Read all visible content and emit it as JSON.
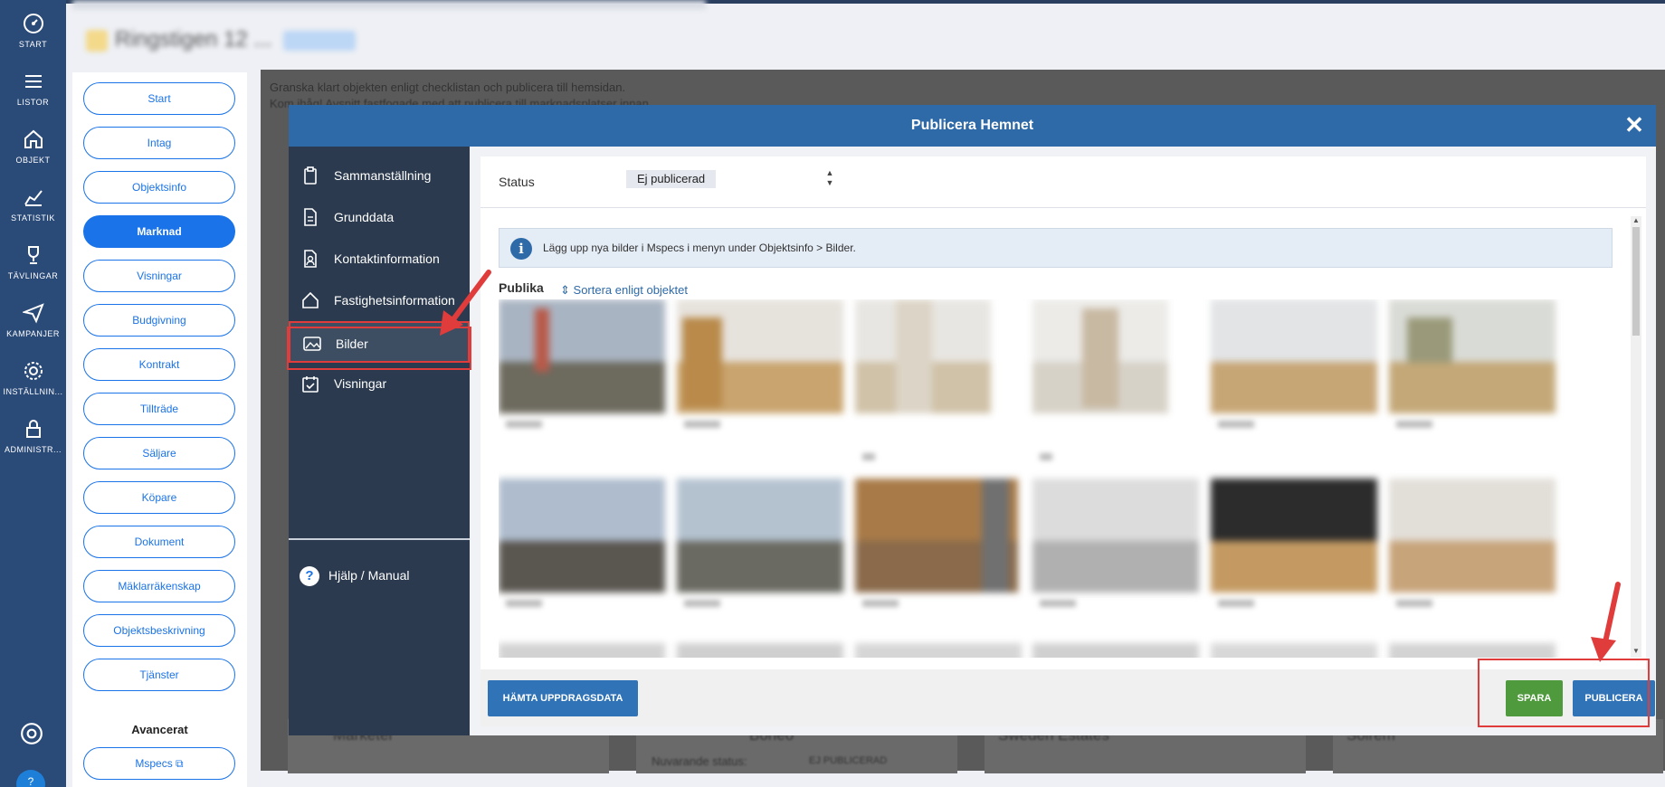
{
  "rail": {
    "items": [
      {
        "label": "START",
        "icon": "gauge-icon"
      },
      {
        "label": "LISTOR",
        "icon": "list-icon"
      },
      {
        "label": "OBJEKT",
        "icon": "home-icon"
      },
      {
        "label": "STATISTIK",
        "icon": "chart-icon"
      },
      {
        "label": "TÄVLINGAR",
        "icon": "trophy-icon"
      },
      {
        "label": "KAMPANJER",
        "icon": "paper-plane-icon"
      },
      {
        "label": "INSTÄLLNIN...",
        "icon": "gear-icon"
      },
      {
        "label": "ADMINISTR...",
        "icon": "lock-icon"
      }
    ],
    "help_label": "?"
  },
  "nav": {
    "items": [
      "Start",
      "Intag",
      "Objektsinfo",
      "Marknad",
      "Visningar",
      "Budgivning",
      "Kontrakt",
      "Tillträde",
      "Säljare",
      "Köpare",
      "Dokument",
      "Mäklarräkenskap",
      "Objektsbeskrivning",
      "Tjänster"
    ],
    "active": "Marknad",
    "section_title": "Avancerat",
    "mspecs_label": "Mspecs"
  },
  "background": {
    "instruction_line1": "Granska klart objekten enligt checklistan och publicera till hemsidan.",
    "instruction_line2": "Kom ihåg! Avsnitt fastfogade med att publicera till marknadsplatser innan ...",
    "cards": [
      {
        "name": "Marketer"
      },
      {
        "name": "Boneo",
        "status_label": "Nuvarande status:",
        "status_value": "EJ PUBLICERAD"
      },
      {
        "name": "Sweden Estates"
      },
      {
        "name": "Solrem"
      }
    ]
  },
  "modal": {
    "title": "Publicera Hemnet",
    "close_symbol": "✕",
    "sidebar": {
      "items": [
        {
          "label": "Sammanställning",
          "icon": "clipboard-icon"
        },
        {
          "label": "Grunddata",
          "icon": "document-icon"
        },
        {
          "label": "Kontaktinformation",
          "icon": "contact-icon"
        },
        {
          "label": "Fastighetsinformation",
          "icon": "house-icon"
        },
        {
          "label": "Bilder",
          "icon": "images-icon"
        },
        {
          "label": "Visningar",
          "icon": "calendar-check-icon"
        }
      ],
      "active": "Bilder",
      "help_label": "Hjälp / Manual"
    },
    "status": {
      "label": "Status",
      "value": "Ej publicerad"
    },
    "info_text": "Lägg upp nya bilder i Mspecs i menyn under Objektsinfo > Bilder.",
    "section_title": "Publika",
    "sort_link": "Sortera enligt objektet",
    "footer": {
      "fetch_button": "HÄMTA UPPDRAGSDATA",
      "save_button": "SPARA",
      "publish_button": "PUBLICERA"
    },
    "colors": {
      "header": "#2e6aa8",
      "sidebar": "#2b3a4e",
      "save": "#4f9a3c",
      "publish": "#3173b7",
      "annotation": "#e03c3c"
    }
  }
}
